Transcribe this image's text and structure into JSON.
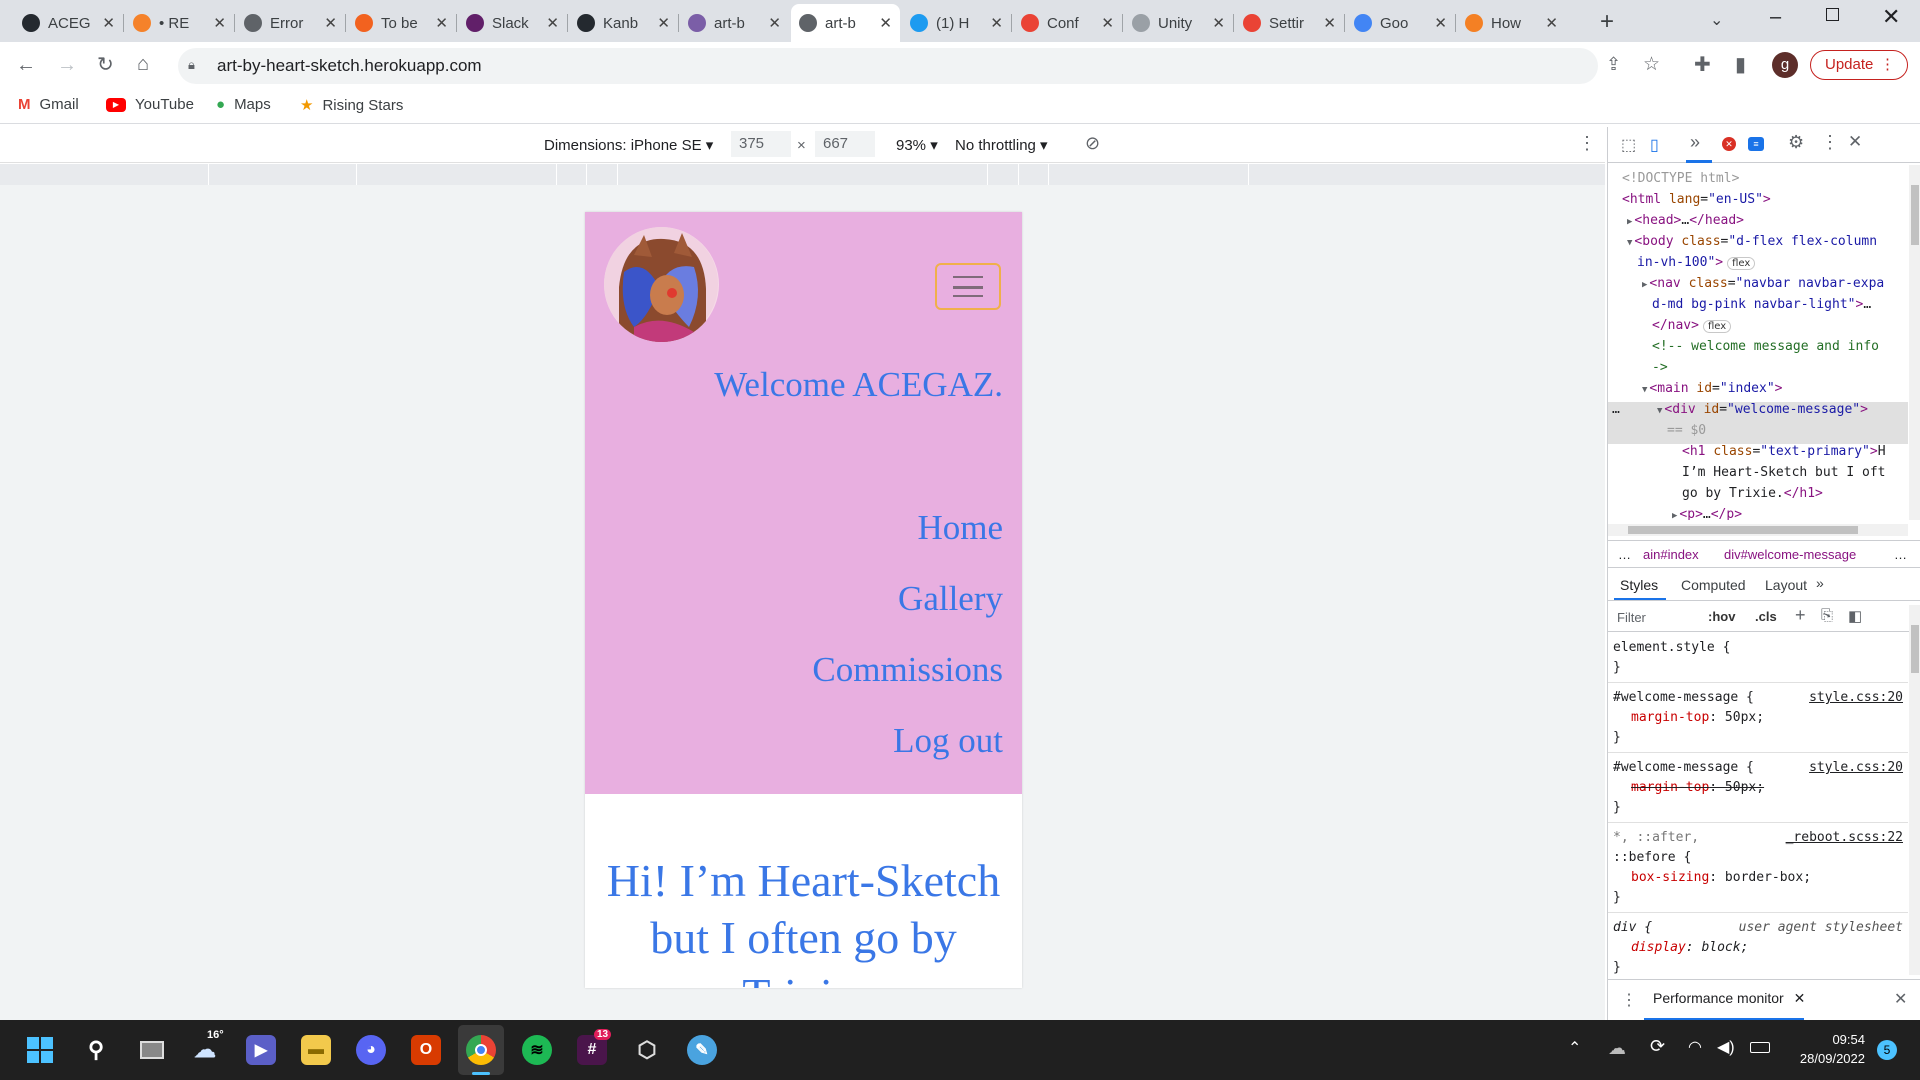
{
  "browser": {
    "tabs": [
      {
        "title": "ACEG",
        "color": "#24292f",
        "icon": "github-icon"
      },
      {
        "title": "• RE",
        "color": "#f5822a",
        "icon": "grammarly-icon"
      },
      {
        "title": "Error",
        "color": "#5f6368",
        "icon": "globe-icon"
      },
      {
        "title": "To be",
        "color": "#f2621f",
        "icon": "circle-icon"
      },
      {
        "title": "Slack",
        "color": "#611f69",
        "icon": "slack-icon"
      },
      {
        "title": "Kanb",
        "color": "#24292f",
        "icon": "github-icon"
      },
      {
        "title": "art-b",
        "color": "#7b5ea7",
        "icon": "heroku-icon"
      },
      {
        "title": "art-b",
        "color": "#5f6368",
        "icon": "globe-icon",
        "active": true
      },
      {
        "title": "(1) H",
        "color": "#1d9bf0",
        "icon": "twitter-icon"
      },
      {
        "title": "Conf",
        "color": "#ea4335",
        "icon": "gmail-icon"
      },
      {
        "title": "Unity",
        "color": "#9aa0a6",
        "icon": "unity-icon"
      },
      {
        "title": "Settir",
        "color": "#ea4335",
        "icon": "gmail-icon"
      },
      {
        "title": "Goo",
        "color": "#4285f4",
        "icon": "google-icon"
      },
      {
        "title": "How",
        "color": "#f48024",
        "icon": "stackoverflow-icon"
      }
    ],
    "url": "art-by-heart-sketch.herokuapp.com",
    "profile_initial": "g",
    "update_label": "Update",
    "bookmarks": [
      {
        "label": "Gmail",
        "icon": "gmail-icon"
      },
      {
        "label": "YouTube",
        "icon": "youtube-icon"
      },
      {
        "label": "Maps",
        "icon": "maps-icon"
      },
      {
        "label": "Rising Stars",
        "icon": "star-icon"
      }
    ]
  },
  "device_toolbar": {
    "dimensions_label": "Dimensions: iPhone SE",
    "width": "375",
    "height": "667",
    "times": "×",
    "zoom": "93%",
    "throttling": "No throttling"
  },
  "site": {
    "welcome": "Welcome ACEGAZ.",
    "nav_links": [
      "Home",
      "Gallery",
      "Commissions",
      "Log out"
    ],
    "heading": "Hi! I’m Heart-Sketch but I often go by Trixie."
  },
  "devtools": {
    "html_lines": [
      {
        "indent": 0,
        "html": "<span class='dim'>&lt;!DOCTYPE html&gt;</span>"
      },
      {
        "indent": 0,
        "html": "<span class='tag'>&lt;html</span> <span class='attr'>lang</span>=<span class='val'>\"en-US\"</span><span class='tag'>&gt;</span>"
      },
      {
        "indent": 1,
        "html": "<span class='tag'>&lt;head&gt;</span>…<span class='tag'>&lt;/head&gt;</span>",
        "arrow": "▶"
      },
      {
        "indent": 1,
        "html": "<span class='tag'>&lt;body</span> <span class='attr'>class</span>=<span class='val'>\"d-flex flex-column</span>",
        "arrow": "▼"
      },
      {
        "indent": 1,
        "html": "<span class='val'>in-vh-100\"</span><span class='tag'>&gt;</span><span class='badge'>flex</span>"
      },
      {
        "indent": 2,
        "html": "<span class='tag'>&lt;nav</span> <span class='attr'>class</span>=<span class='val'>\"navbar navbar-expa</span>",
        "arrow": "▶"
      },
      {
        "indent": 2,
        "html": "<span class='val'>d-md bg-pink navbar-light\"</span><span class='tag'>&gt;</span>…"
      },
      {
        "indent": 2,
        "html": "<span class='tag'>&lt;/nav&gt;</span><span class='badge'>flex</span>"
      },
      {
        "indent": 2,
        "html": "<span class='cmt'>&lt;!-- welcome message and info</span>"
      },
      {
        "indent": 2,
        "html": "<span class='cmt'>-&gt;</span>"
      },
      {
        "indent": 2,
        "html": "<span class='tag'>&lt;main</span> <span class='attr'>id</span>=<span class='val'>\"index\"</span><span class='tag'>&gt;</span>",
        "arrow": "▼"
      },
      {
        "indent": 3,
        "html": "<span class='tag'>&lt;div</span> <span class='attr'>id</span>=<span class='val'>\"welcome-message\"</span><span class='tag'>&gt;</span>",
        "arrow": "▼",
        "selected": true
      },
      {
        "indent": 3,
        "html": "<span class='dim'>== $0</span>",
        "selected": true
      },
      {
        "indent": 4,
        "html": "<span class='tag'>&lt;h1</span> <span class='attr'>class</span>=<span class='val'>\"text-primary\"</span><span class='tag'>&gt;</span>H"
      },
      {
        "indent": 4,
        "html": "I’m Heart-Sketch but I oft"
      },
      {
        "indent": 4,
        "html": "go by Trixie.<span class='tag'>&lt;/h1&gt;</span>"
      },
      {
        "indent": 4,
        "html": "<span class='tag'>&lt;p&gt;</span>…<span class='tag'>&lt;/p&gt;</span>",
        "arrow": "▶"
      }
    ],
    "breadcrumbs": [
      "…",
      "ain#index",
      "div#welcome-message",
      "…"
    ],
    "style_tabs": [
      "Styles",
      "Computed",
      "Layout",
      "»"
    ],
    "filter_placeholder": "Filter",
    "hov": ":hov",
    "cls": ".cls",
    "style_rules": [
      {
        "selector": "element.style {",
        "source": "",
        "prop": "",
        "close": "}"
      },
      {
        "selector": "#welcome-message {",
        "source": "style.css:20",
        "prop": "margin-top: 50px;",
        "close": "}",
        "struck": false
      },
      {
        "selector": "#welcome-message {",
        "source": "style.css:20",
        "prop": "margin-top: 50px;",
        "close": "}",
        "struck": true
      },
      {
        "selector": "*, ::after,",
        "selector2": "::before {",
        "source": "_reboot.scss:22",
        "prop": "box-sizing: border-box;",
        "close": "}"
      },
      {
        "selector": "div {",
        "source": "user agent stylesheet",
        "prop": "display: block;",
        "close": "}",
        "italic": true
      }
    ],
    "drawer_tab": "Performance monitor"
  },
  "taskbar": {
    "weather": "16°",
    "slack_badge": "13",
    "time": "09:54",
    "date": "28/09/2022",
    "notif": "5"
  }
}
